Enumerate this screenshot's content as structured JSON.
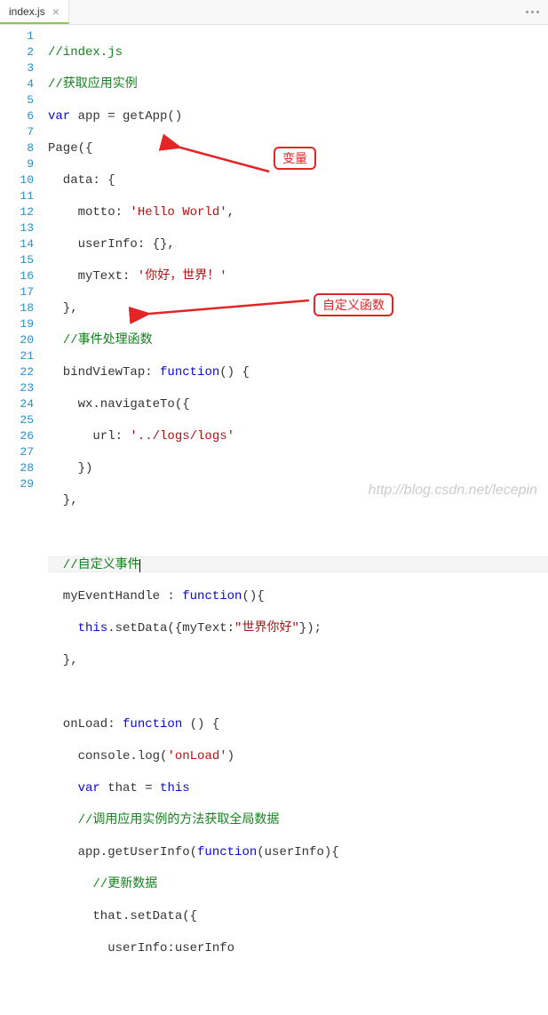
{
  "tab": {
    "filename": "index.js",
    "close": "×"
  },
  "lines": {
    "l1": "//index.js",
    "l2": "//获取应用实例",
    "l3_var": "var",
    "l3_app": " app = getApp()",
    "l4": "Page({",
    "l5": "  data: {",
    "l6a": "    motto: ",
    "l6b": "'Hello World'",
    "l6c": ",",
    "l7": "    userInfo: {},",
    "l8a": "    myText: ",
    "l8b": "'你好，世界！'",
    "l9": "  },",
    "l10": "  //事件处理函数",
    "l11a": "  bindViewTap: ",
    "l11b": "function",
    "l11c": "() {",
    "l12": "    wx.navigateTo({",
    "l13a": "      url: ",
    "l13b": "'../logs/logs'",
    "l14": "    })",
    "l15": "  },",
    "l16": "",
    "l17": "  //自定义事件",
    "l18a": "  myEventHandle : ",
    "l18b": "function",
    "l18c": "(){",
    "l19a": "    ",
    "l19b": "this",
    "l19c": ".setData({myText:",
    "l19d": "\"世界你好\"",
    "l19e": "});",
    "l20": "  },",
    "l21": "",
    "l22a": "  onLoad: ",
    "l22b": "function",
    "l22c": " () {",
    "l23a": "    console.",
    "l23b": "log",
    "l23c": "(",
    "l23d": "'onLoad'",
    "l23e": ")",
    "l24a": "    ",
    "l24b": "var",
    "l24c": " that = ",
    "l24d": "this",
    "l25": "    //调用应用实例的方法获取全局数据",
    "l26a": "    app.getUserInfo(",
    "l26b": "function",
    "l26c": "(userInfo){",
    "l27": "      //更新数据",
    "l28": "      that.setData({",
    "l29": "        userInfo:userInfo"
  },
  "annotations": {
    "a1": "变量",
    "a2": "自定义函数"
  },
  "watermark": "http://blog.csdn.net/lecepin"
}
